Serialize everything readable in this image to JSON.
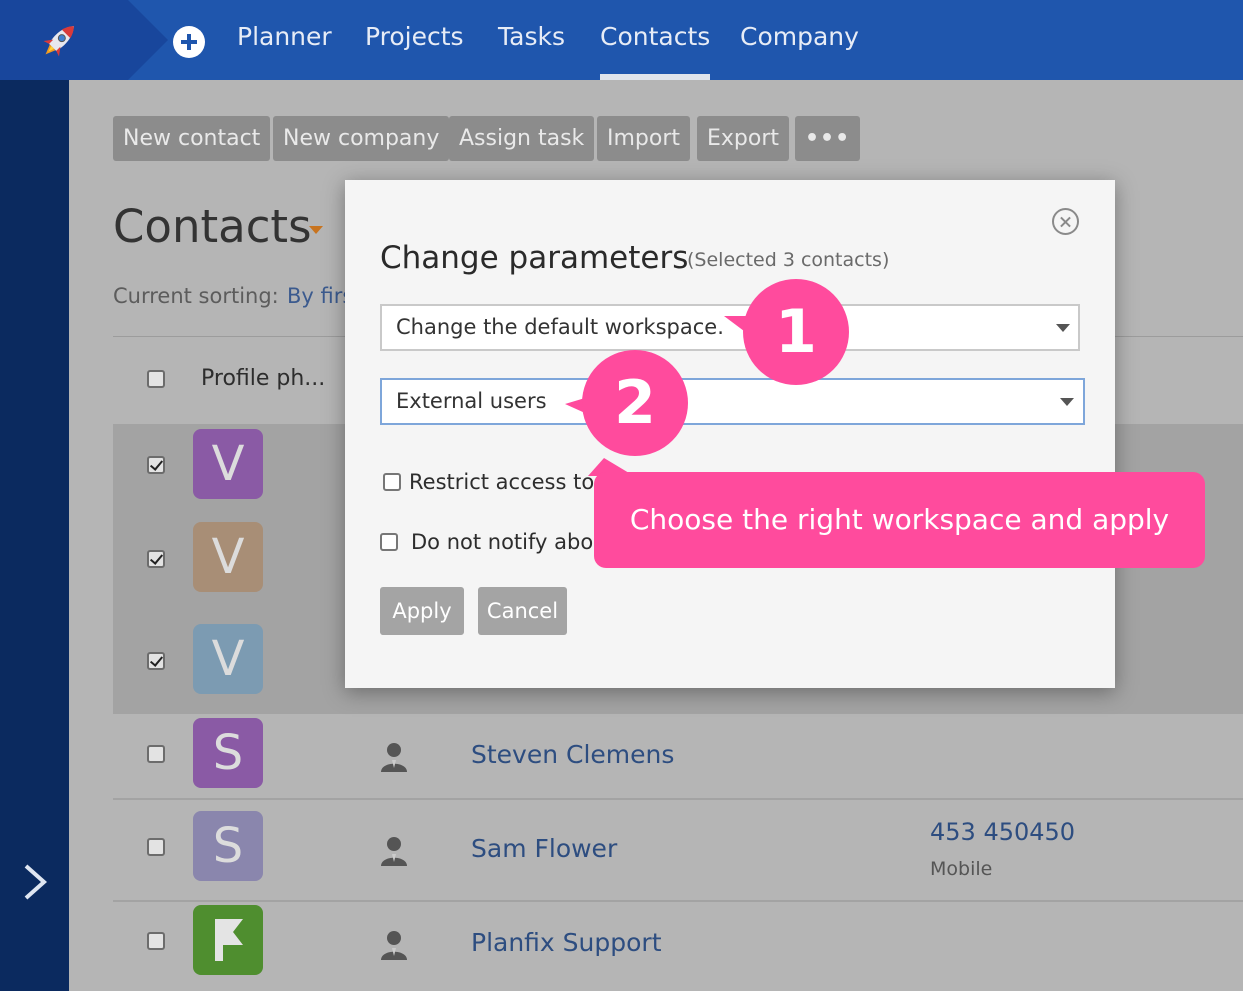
{
  "nav": {
    "items": [
      "Planner",
      "Projects",
      "Tasks",
      "Contacts",
      "Company"
    ],
    "active": "Contacts"
  },
  "toolbar": {
    "buttons": [
      "New contact",
      "New company",
      "Assign task",
      "Import",
      "Export"
    ],
    "more_label": "•••"
  },
  "page": {
    "title": "Contacts",
    "sorting_label": "Current sorting:",
    "sorting_value": "By firs"
  },
  "table": {
    "header": {
      "profile_photo": "Profile ph..."
    },
    "rows": [
      {
        "initial": "V",
        "avatar_color": "#8a5aa5",
        "selected": true,
        "name": "",
        "phone": "",
        "phone_type": ""
      },
      {
        "initial": "V",
        "avatar_color": "#a88e76",
        "selected": true,
        "name": "",
        "phone": "",
        "phone_type": ""
      },
      {
        "initial": "V",
        "avatar_color": "#7c9bb2",
        "selected": true,
        "name": "",
        "phone": "",
        "phone_type": ""
      },
      {
        "initial": "S",
        "avatar_color": "#8a5aa5",
        "selected": false,
        "name": "Steven Clemens",
        "phone": "",
        "phone_type": ""
      },
      {
        "initial": "S",
        "avatar_color": "#8a86ad",
        "selected": false,
        "name": "Sam Flower",
        "phone": "453 450450",
        "phone_type": "Mobile"
      },
      {
        "initial": "F",
        "avatar_color": "#4f8e2f",
        "selected": false,
        "name": "Planfix Support",
        "phone": "",
        "phone_type": ""
      }
    ]
  },
  "modal": {
    "title": "Change parameters",
    "subtitle": "(Selected 3 contacts)",
    "select_action": "Change the default workspace.",
    "select_workspace": "External users",
    "restrict_label": "Restrict access to",
    "notify_label": "Do not notify abo",
    "apply_label": "Apply",
    "cancel_label": "Cancel"
  },
  "annotations": {
    "badge1": "1",
    "badge2": "2",
    "tooltip": "Choose the right workspace and apply",
    "accent_color": "#ff4b9d"
  },
  "colors": {
    "topbar": "#1f56ad",
    "sidebar": "#0b2a5f"
  }
}
